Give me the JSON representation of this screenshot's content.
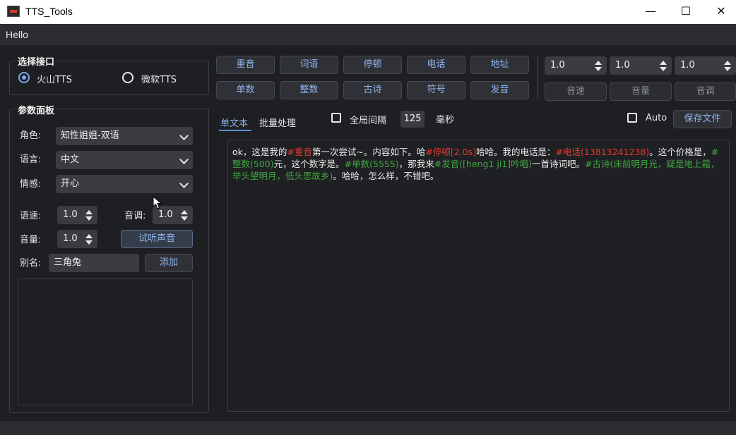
{
  "window": {
    "title": "TTS_Tools",
    "minimize": "—",
    "maximize": "☐",
    "close": "✕"
  },
  "menu": {
    "items": [
      "Hello"
    ]
  },
  "interface": {
    "title": "选择接口",
    "options": [
      {
        "label": "火山TTS",
        "checked": true
      },
      {
        "label": "微软TTS",
        "checked": false
      }
    ]
  },
  "params": {
    "title": "参数面板",
    "role_label": "角色:",
    "role_value": "知性姐姐-双语",
    "language_label": "语言:",
    "language_value": "中文",
    "emotion_label": "情感:",
    "emotion_value": "开心",
    "speed_label": "语速:",
    "speed_value": "1.0",
    "pitch_label": "音调:",
    "pitch_value": "1.0",
    "volume_label": "音量:",
    "volume_value": "1.0",
    "preview_button": "试听声音",
    "alias_label": "别名:",
    "alias_value": "三角兔",
    "add_button": "添加"
  },
  "toolbar": {
    "row1": [
      "重音",
      "词语",
      "停顿",
      "电话",
      "地址"
    ],
    "row2": [
      "单数",
      "整数",
      "古诗",
      "符号",
      "发音"
    ],
    "spins": [
      "1.0",
      "1.0",
      "1.0"
    ],
    "spin_labels": [
      "音速",
      "音量",
      "音调"
    ]
  },
  "tabs": {
    "single": "单文本",
    "batch": "批量处理"
  },
  "options": {
    "global_interval_label": "全局间隔",
    "interval_value": "125",
    "unit": "毫秒",
    "auto_label": "Auto",
    "save_button": "保存文件"
  },
  "editor": {
    "segments": [
      {
        "text": "ok，这是我的",
        "color": "normal"
      },
      {
        "text": "#重音",
        "color": "red"
      },
      {
        "text": "第一次尝试~。内容如下。哈",
        "color": "normal"
      },
      {
        "text": "#停顿[2.0s]",
        "color": "red"
      },
      {
        "text": "哈哈。我的电话是：",
        "color": "normal"
      },
      {
        "text": "#电话(13813241238)",
        "color": "red"
      },
      {
        "text": "。这个价格是，",
        "color": "normal"
      },
      {
        "text": "#整数(500)",
        "color": "green"
      },
      {
        "text": "元，这个数字是。",
        "color": "normal"
      },
      {
        "text": "#单数(5555)",
        "color": "green"
      },
      {
        "text": "，那我来",
        "color": "normal"
      },
      {
        "text": "#发音([heng1 ji1]吟唱)",
        "color": "green"
      },
      {
        "text": "一首诗词吧。",
        "color": "normal"
      },
      {
        "text": "#古诗(床前明月光，疑是地上霜，举头望明月，低头思故乡)",
        "color": "green"
      },
      {
        "text": "。哈哈，怎么样，不错吧。",
        "color": "normal"
      }
    ]
  },
  "colors": {
    "accent": "#8fb4ee",
    "red_tag": "#e23a2e",
    "green_tag": "#3fa63f"
  }
}
